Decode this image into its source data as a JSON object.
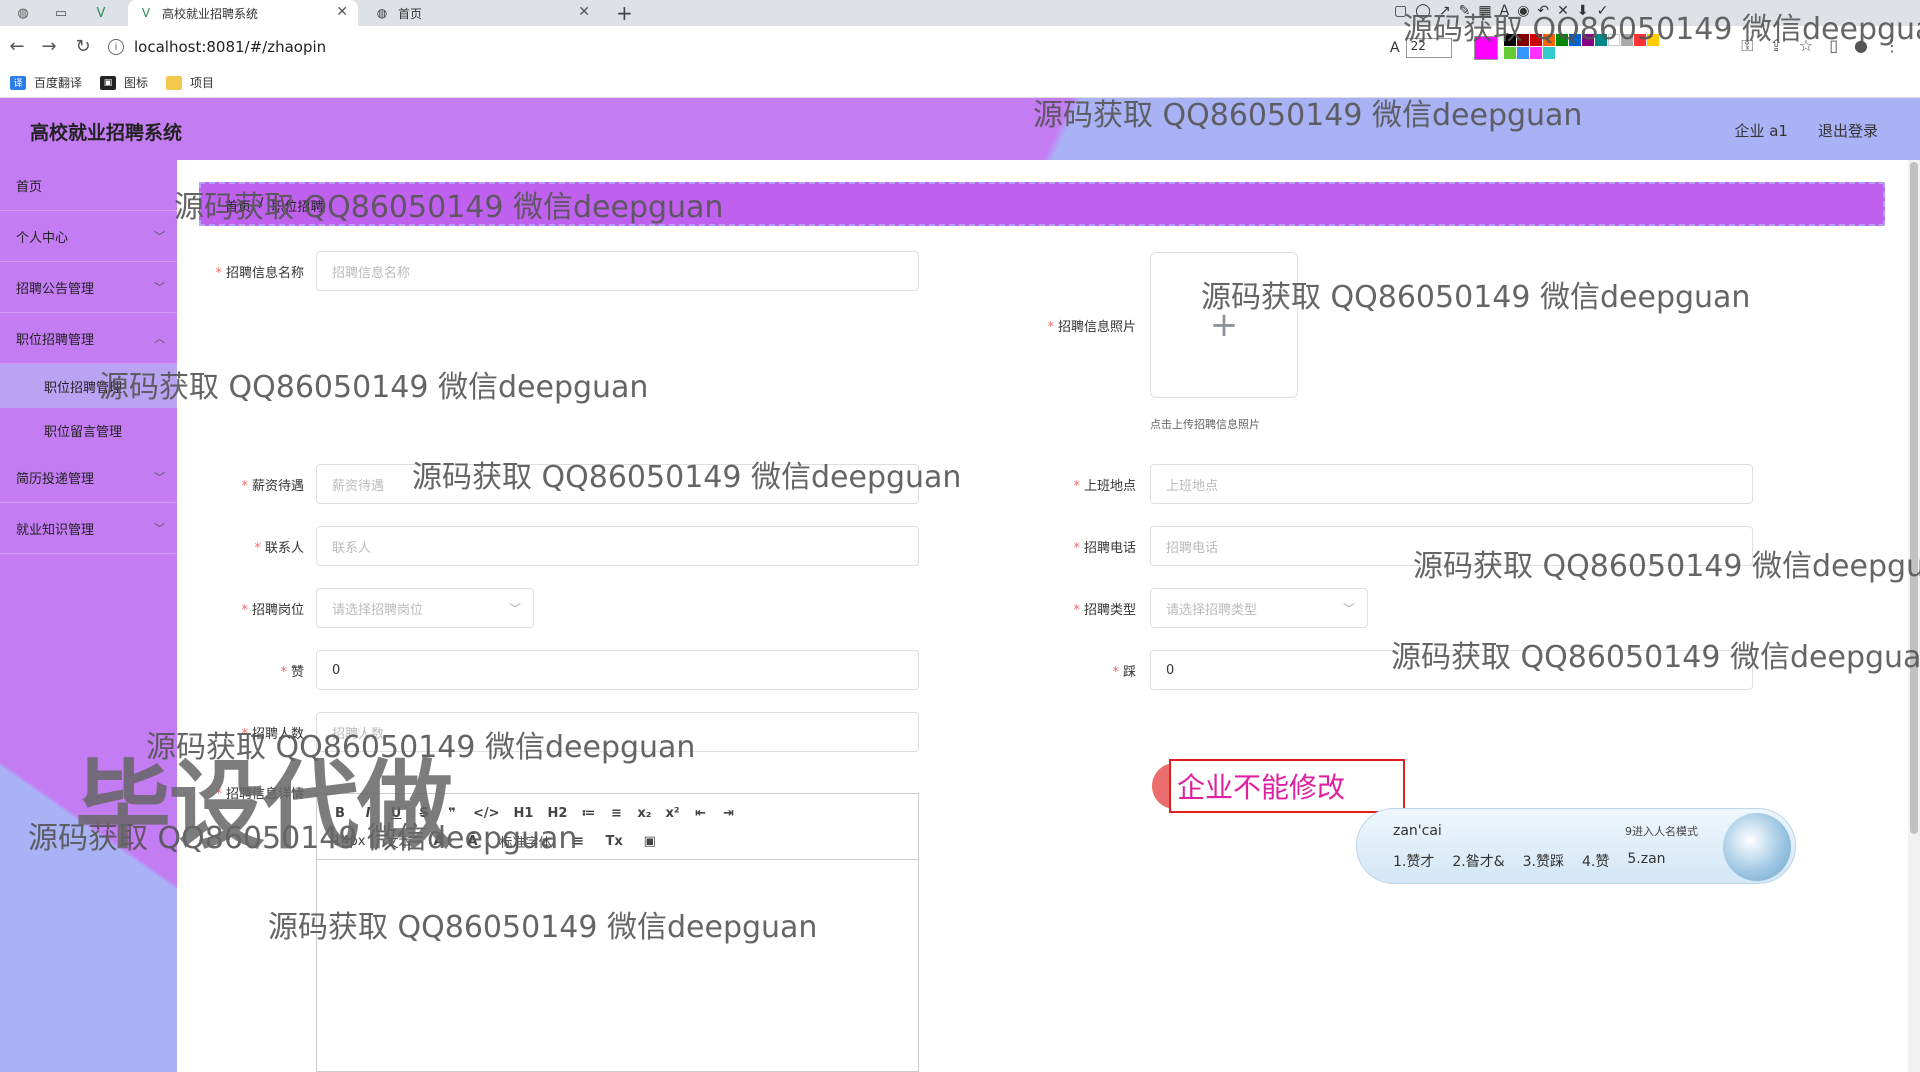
{
  "browser": {
    "tabs": [
      {
        "label": "高校就业招聘系统",
        "active": true
      },
      {
        "label": "首页",
        "active": false
      }
    ],
    "url": "localhost:8081/#/zhaopin",
    "bookmarks": [
      "百度翻译",
      "图标",
      "项目"
    ],
    "draw_font_size": "22"
  },
  "header": {
    "title": "高校就业招聘系统",
    "user": "企业 a1",
    "logout": "退出登录"
  },
  "sidebar": {
    "items": [
      {
        "label": "首页",
        "has_children": false
      },
      {
        "label": "个人中心",
        "has_children": true
      },
      {
        "label": "招聘公告管理",
        "has_children": true
      },
      {
        "label": "职位招聘管理",
        "has_children": true
      },
      {
        "label": "简历投递管理",
        "has_children": true
      },
      {
        "label": "就业知识管理",
        "has_children": true
      }
    ],
    "subitems": [
      "职位招聘管理",
      "职位留言管理"
    ]
  },
  "breadcrumb": [
    "首页",
    "职位招聘"
  ],
  "form": {
    "name_label": "招聘信息名称",
    "name_placeholder": "招聘信息名称",
    "photo_label": "招聘信息照片",
    "photo_tip": "点击上传招聘信息照片",
    "salary_label": "薪资待遇",
    "salary_placeholder": "薪资待遇",
    "location_label": "上班地点",
    "location_placeholder": "上班地点",
    "contact_label": "联系人",
    "contact_placeholder": "联系人",
    "phone_label": "招聘电话",
    "phone_placeholder": "招聘电话",
    "position_label": "招聘岗位",
    "position_placeholder": "请选择招聘岗位",
    "type_label": "招聘类型",
    "type_placeholder": "请选择招聘类型",
    "zan_label": "赞",
    "zan_value": "0",
    "cai_label": "踩",
    "cai_value": "0",
    "count_label": "招聘人数",
    "count_placeholder": "招聘人数",
    "detail_label": "招聘信息详情"
  },
  "editor": {
    "row1": [
      "B",
      "I",
      "U",
      "S",
      "❞",
      "</>",
      "H1",
      "H2",
      "≔",
      "≡",
      "x₂",
      "x²",
      "⇤",
      "⇥"
    ],
    "font_size": "14px",
    "text_style": "文本",
    "font_family": "标准字体"
  },
  "alert": {
    "text": "企业不能修改"
  },
  "ime": {
    "pinyin": "zan'cai",
    "mode": "9进入人名模式",
    "candidates": [
      "1.赞才",
      "2.昝才&",
      "3.赞踩",
      "4.赞",
      "5.zan"
    ]
  },
  "watermarks": {
    "text": "源码获取 QQ86050149 微信deepguan",
    "big": "毕设代做"
  },
  "colors": {
    "header_purple": "#c47cf3",
    "header_blue": "#a8b2f5",
    "breadcrumb_bg": "#c060ee",
    "alert_text": "#e020a0"
  }
}
